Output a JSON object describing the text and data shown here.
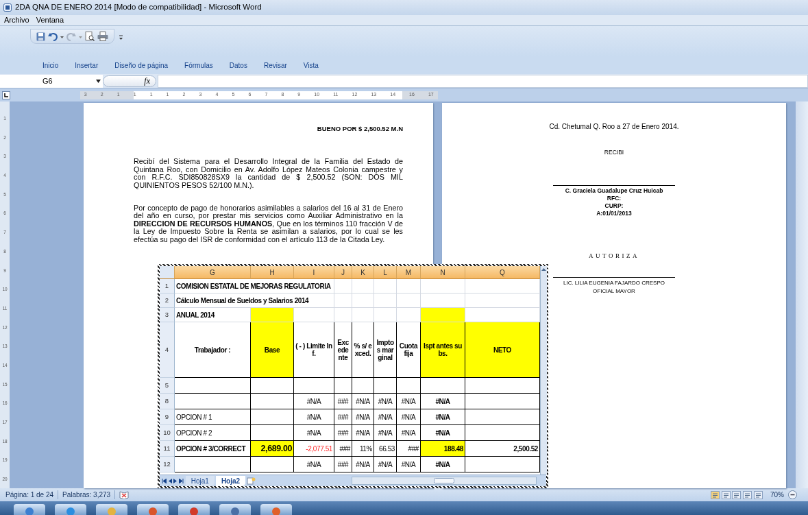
{
  "window": {
    "title": "2DA QNA DE ENERO 2014 [Modo de compatibilidad] - Microsoft Word"
  },
  "menu": [
    "Archivo",
    "Ventana"
  ],
  "ribbon_tabs": [
    "Inicio",
    "Insertar",
    "Diseño de página",
    "Fórmulas",
    "Datos",
    "Revisar",
    "Vista"
  ],
  "formula_bar": {
    "name_box": "G6",
    "fx_label": "fx"
  },
  "ruler": {
    "labels": [
      "3",
      "2",
      "1",
      "1",
      "1",
      "1",
      "2",
      "3",
      "4",
      "5",
      "6",
      "7",
      "8",
      "9",
      "10",
      "11",
      "12",
      "13",
      "14",
      "16",
      "17"
    ]
  },
  "vertical_ruler": {
    "labels": [
      "1",
      "2",
      "3",
      "4",
      "5",
      "6",
      "7",
      "8",
      "9",
      "10",
      "11",
      "12",
      "13",
      "14",
      "15",
      "16",
      "17",
      "18",
      "19",
      "20"
    ]
  },
  "document": {
    "left_page": {
      "heading": "BUENO POR $ 2,500.52 M.N",
      "paragraphs": [
        "Recibí del Sistema para el Desarrollo Integral de la Familia del Estado de Quintana Roo, con Domicilio en Av. Adolfo López Mateos Colonia campestre y con R.F.C. SDI850828SX9 la cantidad de $ 2,500.52 (SON: DOS MIL QUINIENTOS PESOS 52/100 M.N.).",
        "Por concepto de pago de honorarios asimilables a salarios del 16 al 31 de Enero del año en curso, por prestar mis servicios como Auxiliar Administrativo en la **DIRECCION DE RECURSOS HUMANOS**, Que en los términos 110 fracción V de la Ley de Impuesto Sobre la Renta se asimilan a salarios, por lo cual se les efectúa su pago del ISR de conformidad con el artículo 113 de la Citada Ley."
      ]
    },
    "right_page": {
      "blocks": [
        {
          "kind": "date",
          "lines": [
            "Cd. Chetumal Q. Roo a 27 de Enero 2014."
          ]
        },
        {
          "kind": "heading",
          "lines": [
            "RECIBI"
          ]
        },
        {
          "kind": "signature",
          "lines": [
            "C. Graciela Guadalupe Cruz Huicab",
            "RFC:",
            "CURP:",
            "A:01/01/2013"
          ]
        },
        {
          "kind": "title",
          "lines": [
            "AUTORIZA"
          ]
        },
        {
          "kind": "signature-plain",
          "lines": [
            "LIC. LILIA EUGENIA FAJARDO CRESPO",
            "OFICIAL MAYOR"
          ]
        }
      ]
    }
  },
  "spreadsheet": {
    "columns": [
      "G",
      "H",
      "I",
      "J",
      "K",
      "L",
      "M",
      "N",
      "Q"
    ],
    "rows": [
      {
        "number": "1",
        "kind": "title",
        "cells": [
          {
            "text": "COMISION ESTATAL DE MEJORAS REGULATORIA",
            "kind": "banner"
          },
          {
            "kind": "plain"
          },
          {
            "kind": "plain"
          },
          {
            "kind": "plain"
          },
          {
            "kind": "plain"
          },
          {
            "kind": "plain"
          },
          {
            "kind": "plain"
          }
        ]
      },
      {
        "number": "2",
        "kind": "title",
        "cells": [
          {
            "text": "Cálculo Mensual de Sueldos y Salarios 2014",
            "kind": "banner"
          },
          {
            "kind": "plain"
          },
          {
            "kind": "plain"
          },
          {
            "kind": "plain"
          },
          {
            "kind": "plain"
          },
          {
            "kind": "plain"
          },
          {
            "kind": "plain"
          }
        ]
      },
      {
        "number": "3",
        "kind": "title",
        "cells": [
          {
            "text": "ANUAL 2014",
            "kind": "bold"
          },
          {
            "kind": "highlight"
          },
          {
            "kind": "plain"
          },
          {
            "kind": "plain"
          },
          {
            "kind": "plain"
          },
          {
            "kind": "plain"
          },
          {
            "kind": "plain"
          },
          {
            "kind": "highlight"
          },
          {
            "kind": "plain"
          }
        ]
      },
      {
        "number": "4",
        "kind": "header",
        "cells": [
          {
            "text": "Trabajador :",
            "kind": "bold"
          },
          {
            "text": "Base",
            "kind": "highlight"
          },
          {
            "text": "( - ) Limite Inf.",
            "kind": "bold"
          },
          {
            "text": "Excedente",
            "kind": "bold"
          },
          {
            "text": "% s/ exced.",
            "kind": "bold"
          },
          {
            "text": "Imptos marginal",
            "kind": "bold"
          },
          {
            "text": "Cuota fija",
            "kind": "bold"
          },
          {
            "text": "Ispt antes subs.",
            "kind": "highlight"
          },
          {
            "text": "NETO",
            "kind": "highlight"
          }
        ]
      },
      {
        "number": "5",
        "kind": "data",
        "cells": [
          {
            "kind": "plain"
          },
          {
            "kind": "plain"
          },
          {
            "kind": "plain"
          },
          {
            "kind": "plain"
          },
          {
            "kind": "plain"
          },
          {
            "kind": "plain"
          },
          {
            "kind": "plain"
          },
          {
            "kind": "plain"
          },
          {
            "kind": "plain"
          }
        ]
      },
      {
        "number": "8",
        "kind": "data",
        "cells": [
          {
            "kind": "plain"
          },
          {
            "kind": "plain"
          },
          {
            "text": "#N/A",
            "kind": "plain"
          },
          {
            "text": "###",
            "kind": "plain"
          },
          {
            "text": "#N/A",
            "kind": "plain"
          },
          {
            "text": "#N/A",
            "kind": "plain"
          },
          {
            "text": "#N/A",
            "kind": "plain"
          },
          {
            "text": "#N/A",
            "kind": "bold"
          },
          {
            "kind": "plain"
          }
        ]
      },
      {
        "number": "9",
        "kind": "data",
        "cells": [
          {
            "text": "OPCION # 1",
            "kind": "plain"
          },
          {
            "kind": "plain"
          },
          {
            "text": "#N/A",
            "kind": "plain"
          },
          {
            "text": "###",
            "kind": "plain"
          },
          {
            "text": "#N/A",
            "kind": "plain"
          },
          {
            "text": "#N/A",
            "kind": "plain"
          },
          {
            "text": "#N/A",
            "kind": "plain"
          },
          {
            "text": "#N/A",
            "kind": "bold"
          },
          {
            "kind": "plain"
          }
        ]
      },
      {
        "number": "10",
        "kind": "data",
        "cells": [
          {
            "text": "OPCION # 2",
            "kind": "plain"
          },
          {
            "kind": "plain"
          },
          {
            "text": "#N/A",
            "kind": "plain"
          },
          {
            "text": "###",
            "kind": "plain"
          },
          {
            "text": "#N/A",
            "kind": "plain"
          },
          {
            "text": "#N/A",
            "kind": "plain"
          },
          {
            "text": "#N/A",
            "kind": "plain"
          },
          {
            "text": "#N/A",
            "kind": "bold"
          },
          {
            "kind": "plain"
          }
        ]
      },
      {
        "number": "11",
        "kind": "totals",
        "cells": [
          {
            "text": "OPCION # 3/CORRECT",
            "kind": "bold"
          },
          {
            "text": "2,689.00",
            "kind": "highlight"
          },
          {
            "text": "-2,077.51",
            "kind": "negative"
          },
          {
            "text": "###",
            "kind": "plain"
          },
          {
            "text": "11%",
            "kind": "plain"
          },
          {
            "text": "66.53",
            "kind": "plain"
          },
          {
            "text": "###",
            "kind": "plain"
          },
          {
            "text": "188.48",
            "kind": "highlight"
          },
          {
            "text": "2,500.52",
            "kind": "bold"
          }
        ]
      },
      {
        "number": "12",
        "kind": "data",
        "cells": [
          {
            "kind": "plain"
          },
          {
            "kind": "plain"
          },
          {
            "text": "#N/A",
            "kind": "plain"
          },
          {
            "text": "###",
            "kind": "plain"
          },
          {
            "text": "#N/A",
            "kind": "plain"
          },
          {
            "text": "#N/A",
            "kind": "plain"
          },
          {
            "text": "#N/A",
            "kind": "plain"
          },
          {
            "text": "#N/A",
            "kind": "bold"
          },
          {
            "kind": "plain"
          }
        ]
      }
    ],
    "sheet_tabs": [
      {
        "label": "Hoja1",
        "selected": false
      },
      {
        "label": "Hoja2",
        "selected": true
      }
    ]
  },
  "status_bar": {
    "page": "Página: 1 de 24",
    "words": "Palabras: 3,273",
    "zoom": "70%"
  }
}
